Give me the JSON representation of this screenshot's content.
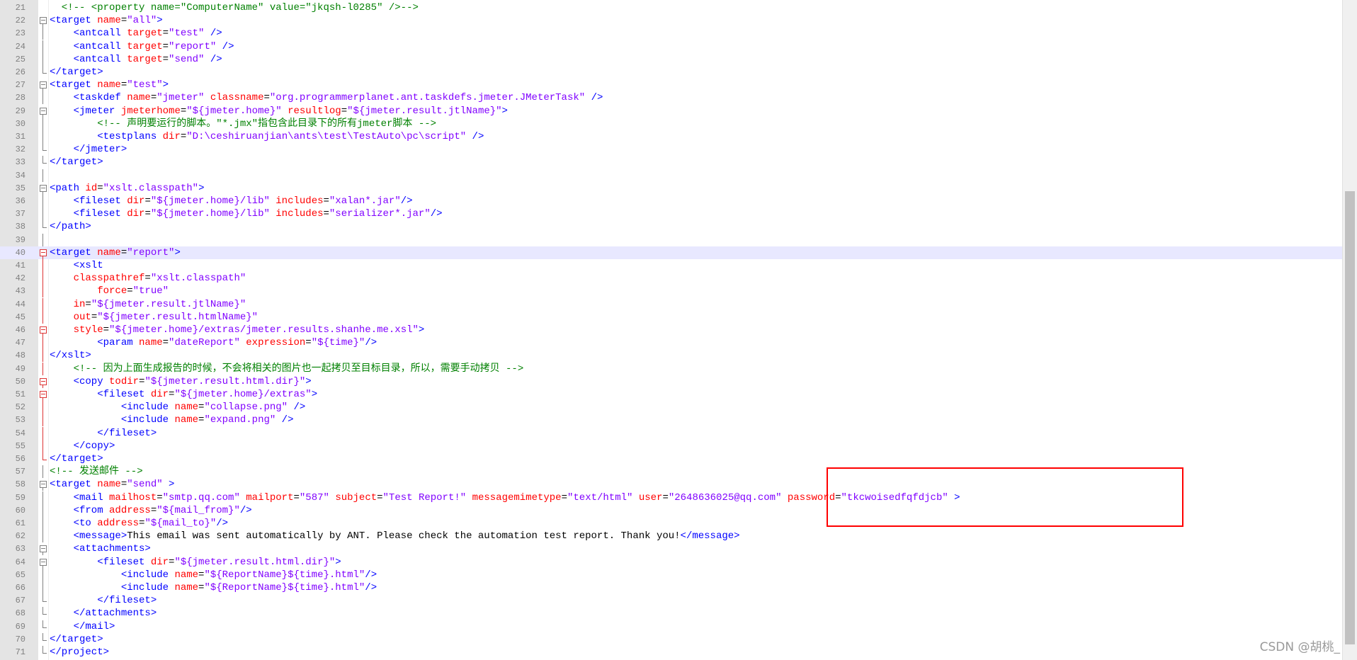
{
  "editor": {
    "lines": [
      {
        "n": "21",
        "fold": "",
        "segs": [
          [
            "cmt",
            "  <!-- <property name=\"ComputerName\" value=\"jkqsh-l0285\" />-->"
          ]
        ]
      },
      {
        "n": "22",
        "fold": "box",
        "segs": [
          [
            "tag",
            "<target "
          ],
          [
            "attr",
            "name"
          ],
          [
            "plain",
            "="
          ],
          [
            "val",
            "\"all\""
          ],
          [
            "tag",
            ">"
          ]
        ]
      },
      {
        "n": "23",
        "fold": "",
        "segs": [
          [
            "tag",
            "    <antcall "
          ],
          [
            "attr",
            "target"
          ],
          [
            "plain",
            "="
          ],
          [
            "val",
            "\"test\""
          ],
          [
            "tag",
            " />"
          ]
        ]
      },
      {
        "n": "24",
        "fold": "",
        "segs": [
          [
            "tag",
            "    <antcall "
          ],
          [
            "attr",
            "target"
          ],
          [
            "plain",
            "="
          ],
          [
            "val",
            "\"report\""
          ],
          [
            "tag",
            " />"
          ]
        ]
      },
      {
        "n": "25",
        "fold": "",
        "segs": [
          [
            "tag",
            "    <antcall "
          ],
          [
            "attr",
            "target"
          ],
          [
            "plain",
            "="
          ],
          [
            "val",
            "\"send\""
          ],
          [
            "tag",
            " />"
          ]
        ]
      },
      {
        "n": "26",
        "fold": "end",
        "segs": [
          [
            "tag",
            "</target>"
          ]
        ]
      },
      {
        "n": "27",
        "fold": "box",
        "segs": [
          [
            "tag",
            "<target "
          ],
          [
            "attr",
            "name"
          ],
          [
            "plain",
            "="
          ],
          [
            "val",
            "\"test\""
          ],
          [
            "tag",
            ">"
          ]
        ]
      },
      {
        "n": "28",
        "fold": "",
        "segs": [
          [
            "tag",
            "    <taskdef "
          ],
          [
            "attr",
            "name"
          ],
          [
            "plain",
            "="
          ],
          [
            "val",
            "\"jmeter\""
          ],
          [
            "tag",
            " "
          ],
          [
            "attr",
            "classname"
          ],
          [
            "plain",
            "="
          ],
          [
            "val",
            "\"org.programmerplanet.ant.taskdefs.jmeter.JMeterTask\""
          ],
          [
            "tag",
            " />"
          ]
        ]
      },
      {
        "n": "29",
        "fold": "box",
        "segs": [
          [
            "tag",
            "    <jmeter "
          ],
          [
            "attr",
            "jmeterhome"
          ],
          [
            "plain",
            "="
          ],
          [
            "val",
            "\"${jmeter.home}\""
          ],
          [
            "tag",
            " "
          ],
          [
            "attr",
            "resultlog"
          ],
          [
            "plain",
            "="
          ],
          [
            "val",
            "\"${jmeter.result.jtlName}\""
          ],
          [
            "tag",
            ">"
          ]
        ]
      },
      {
        "n": "30",
        "fold": "",
        "segs": [
          [
            "cmt",
            "        <!-- 声明要运行的脚本。\"*.jmx\"指包含此目录下的所有jmeter脚本 -->"
          ]
        ]
      },
      {
        "n": "31",
        "fold": "",
        "segs": [
          [
            "tag",
            "        <testplans "
          ],
          [
            "attr",
            "dir"
          ],
          [
            "plain",
            "="
          ],
          [
            "val",
            "\"D:\\ceshiruanjian\\ants\\test\\TestAuto\\pc\\script\""
          ],
          [
            "tag",
            " />"
          ]
        ]
      },
      {
        "n": "32",
        "fold": "end",
        "segs": [
          [
            "tag",
            "    </jmeter>"
          ]
        ]
      },
      {
        "n": "33",
        "fold": "end",
        "segs": [
          [
            "tag",
            "</target>"
          ]
        ]
      },
      {
        "n": "34",
        "fold": "",
        "segs": [
          [
            "plain",
            ""
          ]
        ]
      },
      {
        "n": "35",
        "fold": "box",
        "segs": [
          [
            "tag",
            "<path "
          ],
          [
            "attr",
            "id"
          ],
          [
            "plain",
            "="
          ],
          [
            "val",
            "\"xslt.classpath\""
          ],
          [
            "tag",
            ">"
          ]
        ]
      },
      {
        "n": "36",
        "fold": "",
        "segs": [
          [
            "tag",
            "    <fileset "
          ],
          [
            "attr",
            "dir"
          ],
          [
            "plain",
            "="
          ],
          [
            "val",
            "\"${jmeter.home}/lib\""
          ],
          [
            "tag",
            " "
          ],
          [
            "attr",
            "includes"
          ],
          [
            "plain",
            "="
          ],
          [
            "val",
            "\"xalan*.jar\""
          ],
          [
            "tag",
            "/>"
          ]
        ]
      },
      {
        "n": "37",
        "fold": "",
        "segs": [
          [
            "tag",
            "    <fileset "
          ],
          [
            "attr",
            "dir"
          ],
          [
            "plain",
            "="
          ],
          [
            "val",
            "\"${jmeter.home}/lib\""
          ],
          [
            "tag",
            " "
          ],
          [
            "attr",
            "includes"
          ],
          [
            "plain",
            "="
          ],
          [
            "val",
            "\"serializer*.jar\""
          ],
          [
            "tag",
            "/>"
          ]
        ]
      },
      {
        "n": "38",
        "fold": "end",
        "segs": [
          [
            "tag",
            "</path>"
          ]
        ]
      },
      {
        "n": "39",
        "fold": "",
        "segs": [
          [
            "plain",
            ""
          ]
        ]
      },
      {
        "n": "40",
        "fold": "boxred",
        "current": true,
        "segs": [
          [
            "tag",
            "<target "
          ],
          [
            "attr",
            "name"
          ],
          [
            "plain",
            "="
          ],
          [
            "val",
            "\"report\""
          ],
          [
            "tag",
            ">"
          ]
        ]
      },
      {
        "n": "41",
        "fold": "red",
        "segs": [
          [
            "tag",
            "    <xslt"
          ]
        ]
      },
      {
        "n": "42",
        "fold": "red",
        "segs": [
          [
            "attr",
            "    classpathref"
          ],
          [
            "plain",
            "="
          ],
          [
            "val",
            "\"xslt.classpath\""
          ]
        ]
      },
      {
        "n": "43",
        "fold": "red",
        "segs": [
          [
            "attr",
            "        force"
          ],
          [
            "plain",
            "="
          ],
          [
            "val",
            "\"true\""
          ]
        ]
      },
      {
        "n": "44",
        "fold": "red",
        "segs": [
          [
            "attr",
            "    in"
          ],
          [
            "plain",
            "="
          ],
          [
            "val",
            "\"${jmeter.result.jtlName}\""
          ]
        ]
      },
      {
        "n": "45",
        "fold": "red",
        "segs": [
          [
            "attr",
            "    out"
          ],
          [
            "plain",
            "="
          ],
          [
            "val",
            "\"${jmeter.result.htmlName}\""
          ]
        ]
      },
      {
        "n": "46",
        "fold": "boxred",
        "segs": [
          [
            "attr",
            "    style"
          ],
          [
            "plain",
            "="
          ],
          [
            "val",
            "\"${jmeter.home}/extras/jmeter.results.shanhe.me.xsl\""
          ],
          [
            "tag",
            ">"
          ]
        ]
      },
      {
        "n": "47",
        "fold": "red",
        "segs": [
          [
            "tag",
            "        <param "
          ],
          [
            "attr",
            "name"
          ],
          [
            "plain",
            "="
          ],
          [
            "val",
            "\"dateReport\""
          ],
          [
            "tag",
            " "
          ],
          [
            "attr",
            "expression"
          ],
          [
            "plain",
            "="
          ],
          [
            "val",
            "\"${time}\""
          ],
          [
            "tag",
            "/>"
          ]
        ]
      },
      {
        "n": "48",
        "fold": "red",
        "segs": [
          [
            "tag",
            "</xslt>"
          ]
        ]
      },
      {
        "n": "49",
        "fold": "red",
        "segs": [
          [
            "cmt",
            "    <!-- 因为上面生成报告的时候，不会将相关的图片也一起拷贝至目标目录，所以，需要手动拷贝 -->"
          ]
        ]
      },
      {
        "n": "50",
        "fold": "boxred",
        "segs": [
          [
            "tag",
            "    <copy "
          ],
          [
            "attr",
            "todir"
          ],
          [
            "plain",
            "="
          ],
          [
            "val",
            "\"${jmeter.result.html.dir}\""
          ],
          [
            "tag",
            ">"
          ]
        ]
      },
      {
        "n": "51",
        "fold": "boxred",
        "segs": [
          [
            "tag",
            "        <fileset "
          ],
          [
            "attr",
            "dir"
          ],
          [
            "plain",
            "="
          ],
          [
            "val",
            "\"${jmeter.home}/extras\""
          ],
          [
            "tag",
            ">"
          ]
        ]
      },
      {
        "n": "52",
        "fold": "red",
        "segs": [
          [
            "tag",
            "            <include "
          ],
          [
            "attr",
            "name"
          ],
          [
            "plain",
            "="
          ],
          [
            "val",
            "\"collapse.png\""
          ],
          [
            "tag",
            " />"
          ]
        ]
      },
      {
        "n": "53",
        "fold": "red",
        "segs": [
          [
            "tag",
            "            <include "
          ],
          [
            "attr",
            "name"
          ],
          [
            "plain",
            "="
          ],
          [
            "val",
            "\"expand.png\""
          ],
          [
            "tag",
            " />"
          ]
        ]
      },
      {
        "n": "54",
        "fold": "red",
        "segs": [
          [
            "tag",
            "        </fileset>"
          ]
        ]
      },
      {
        "n": "55",
        "fold": "red",
        "segs": [
          [
            "tag",
            "    </copy>"
          ]
        ]
      },
      {
        "n": "56",
        "fold": "endred",
        "segs": [
          [
            "tag",
            "</target>"
          ]
        ]
      },
      {
        "n": "57",
        "fold": "",
        "segs": [
          [
            "cmt",
            "<!-- 发送邮件 -->"
          ]
        ]
      },
      {
        "n": "58",
        "fold": "box",
        "segs": [
          [
            "tag",
            "<target "
          ],
          [
            "attr",
            "name"
          ],
          [
            "plain",
            "="
          ],
          [
            "val",
            "\"send\""
          ],
          [
            "tag",
            " >"
          ]
        ]
      },
      {
        "n": "59",
        "fold": "",
        "segs": [
          [
            "tag",
            "    <mail "
          ],
          [
            "attr",
            "mailhost"
          ],
          [
            "plain",
            "="
          ],
          [
            "val",
            "\"smtp.qq.com\""
          ],
          [
            "tag",
            " "
          ],
          [
            "attr",
            "mailport"
          ],
          [
            "plain",
            "="
          ],
          [
            "val",
            "\"587\""
          ],
          [
            "tag",
            " "
          ],
          [
            "attr",
            "subject"
          ],
          [
            "plain",
            "="
          ],
          [
            "val",
            "\"Test Report!\""
          ],
          [
            "tag",
            " "
          ],
          [
            "attr",
            "messagemimetype"
          ],
          [
            "plain",
            "="
          ],
          [
            "val",
            "\"text/html\""
          ],
          [
            "tag",
            " "
          ],
          [
            "attr",
            "user"
          ],
          [
            "plain",
            "="
          ],
          [
            "val",
            "\"2648636025@qq.com\""
          ],
          [
            "tag",
            " "
          ],
          [
            "attr",
            "password"
          ],
          [
            "plain",
            "="
          ],
          [
            "val",
            "\"tkcwoisedfqfdjcb\""
          ],
          [
            "tag",
            " >"
          ]
        ]
      },
      {
        "n": "60",
        "fold": "",
        "segs": [
          [
            "tag",
            "    <from "
          ],
          [
            "attr",
            "address"
          ],
          [
            "plain",
            "="
          ],
          [
            "val",
            "\"${mail_from}\""
          ],
          [
            "tag",
            "/>"
          ]
        ]
      },
      {
        "n": "61",
        "fold": "",
        "segs": [
          [
            "tag",
            "    <to "
          ],
          [
            "attr",
            "address"
          ],
          [
            "plain",
            "="
          ],
          [
            "val",
            "\"${mail_to}\""
          ],
          [
            "tag",
            "/>"
          ]
        ]
      },
      {
        "n": "62",
        "fold": "",
        "segs": [
          [
            "tag",
            "    <message>"
          ],
          [
            "plain",
            "This email was sent automatically by ANT. Please check the automation test report. Thank you!"
          ],
          [
            "tag",
            "</message>"
          ]
        ]
      },
      {
        "n": "63",
        "fold": "box",
        "segs": [
          [
            "tag",
            "    <attachments>"
          ]
        ]
      },
      {
        "n": "64",
        "fold": "box",
        "segs": [
          [
            "tag",
            "        <fileset "
          ],
          [
            "attr",
            "dir"
          ],
          [
            "plain",
            "="
          ],
          [
            "val",
            "\"${jmeter.result.html.dir}\""
          ],
          [
            "tag",
            ">"
          ]
        ]
      },
      {
        "n": "65",
        "fold": "",
        "segs": [
          [
            "tag",
            "            <include "
          ],
          [
            "attr",
            "name"
          ],
          [
            "plain",
            "="
          ],
          [
            "val",
            "\"${ReportName}${time}.html\""
          ],
          [
            "tag",
            "/>"
          ]
        ]
      },
      {
        "n": "66",
        "fold": "",
        "segs": [
          [
            "tag",
            "            <include "
          ],
          [
            "attr",
            "name"
          ],
          [
            "plain",
            "="
          ],
          [
            "val",
            "\"${ReportName}${time}.html\""
          ],
          [
            "tag",
            "/>"
          ]
        ]
      },
      {
        "n": "67",
        "fold": "end",
        "segs": [
          [
            "tag",
            "        </fileset>"
          ]
        ]
      },
      {
        "n": "68",
        "fold": "end",
        "segs": [
          [
            "tag",
            "    </attachments>"
          ]
        ]
      },
      {
        "n": "69",
        "fold": "end",
        "segs": [
          [
            "tag",
            "    </mail>"
          ]
        ]
      },
      {
        "n": "70",
        "fold": "end",
        "segs": [
          [
            "tag",
            "</target>"
          ]
        ]
      },
      {
        "n": "71",
        "fold": "end",
        "segs": [
          [
            "tag",
            "</project>"
          ]
        ]
      }
    ]
  },
  "colors": {
    "tag": "#0000ff",
    "attribute": "#ff0000",
    "value": "#8000ff",
    "comment": "#008000",
    "highlight_box": "#ff0000",
    "current_line": "#e8e8ff"
  },
  "watermark": "CSDN @胡桃_"
}
